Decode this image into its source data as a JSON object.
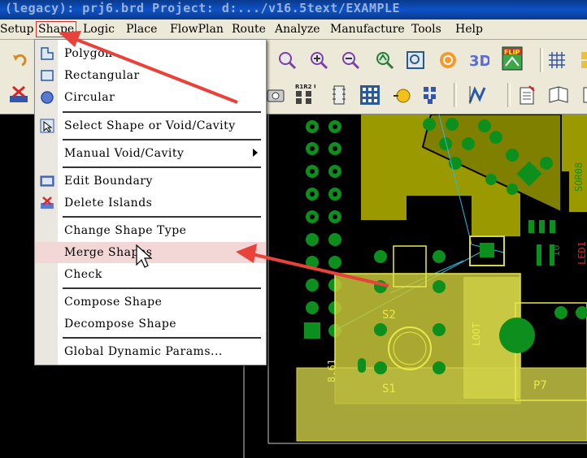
{
  "window": {
    "title": "(legacy): prj6.brd  Project: d:.../v16.5text/EXAMPLE"
  },
  "menubar": {
    "items": [
      "Setup",
      "Shape",
      "Logic",
      "Place",
      "FlowPlan",
      "Route",
      "Analyze",
      "Manufacture",
      "Tools",
      "Help"
    ],
    "active": "Shape"
  },
  "shape_menu": {
    "items": [
      {
        "label": "Polygon",
        "icon": "polygon-icon"
      },
      {
        "label": "Rectangular",
        "icon": "rectangle-icon"
      },
      {
        "label": "Circular",
        "icon": "circle-icon"
      },
      {
        "label": "Select Shape or Void/Cavity",
        "icon": "select-shape-icon"
      },
      {
        "label": "Manual Void/Cavity",
        "icon": "",
        "submenu": true
      },
      {
        "label": "Edit Boundary",
        "icon": "edit-boundary-icon"
      },
      {
        "label": "Delete Islands",
        "icon": "delete-islands-icon"
      },
      {
        "label": "Change Shape Type",
        "icon": ""
      },
      {
        "label": "Merge Shapes",
        "icon": "",
        "highlighted": true
      },
      {
        "label": "Check",
        "icon": ""
      },
      {
        "label": "Compose Shape",
        "icon": ""
      },
      {
        "label": "Decompose Shape",
        "icon": ""
      },
      {
        "label": "Global Dynamic Params...",
        "icon": ""
      }
    ]
  },
  "toolbar_buttons": {
    "row1": [
      "undo-icon",
      "zoom-fit-icon",
      "zoom-in-icon",
      "zoom-out-icon",
      "zoom-previous-icon",
      "zoom-window-icon",
      "refresh-icon",
      "3d-view-icon",
      "flip-icon",
      "grid-icon",
      "color-icon"
    ],
    "row2": [
      "delete-icon",
      "camera-icon",
      "swap-icon",
      "component-icon",
      "via-array-icon",
      "test-point-icon",
      "place-grid-icon",
      "route-icon",
      "report-icon",
      "document-icon"
    ]
  },
  "toolbar_labels": {
    "flip": "FLIP",
    "threed": "3D",
    "swap": "R1R2 U1 U2"
  },
  "board": {
    "silkscreen": [
      "S2",
      "S1",
      "P7",
      "LOOT",
      "8.61",
      "SOR08",
      "10",
      "LED1"
    ],
    "colors": {
      "shape": "#9a9a00",
      "shape_light": "#d6d64a",
      "pad": "#0d8f1e",
      "ratsnest": "#2fb8e0",
      "outline": "#c9c9c9"
    }
  },
  "annotations": {
    "arrow_color": "#e8423a"
  }
}
